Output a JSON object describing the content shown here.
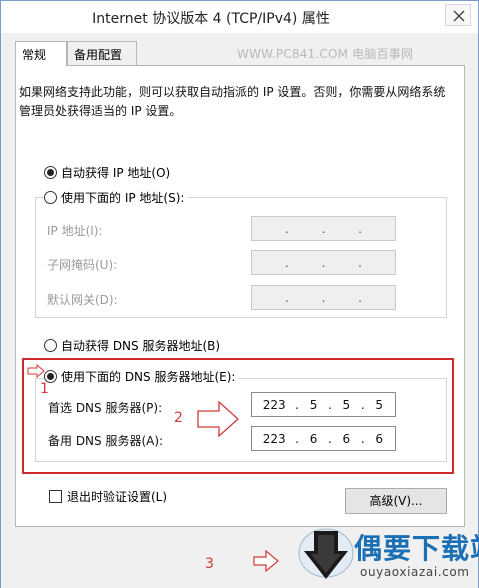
{
  "window": {
    "title": "Internet 协议版本 4 (TCP/IPv4) 属性"
  },
  "tabs": [
    {
      "label": "常规"
    },
    {
      "label": "备用配置"
    }
  ],
  "watermark": "WWW.PC841.COM 电脑百事网",
  "description": "如果网络支持此功能，则可以获取自动指派的 IP 设置。否则，你需要从网络系统管理员处获得适当的 IP 设置。",
  "ip_section": {
    "auto_label": "自动获得 IP 地址(O)",
    "auto_checked": true,
    "manual_label": "使用下面的 IP 地址(S):",
    "manual_checked": false,
    "fields": [
      {
        "label": "IP 地址(I):",
        "value": [
          "",
          "",
          "",
          ""
        ]
      },
      {
        "label": "子网掩码(U):",
        "value": [
          "",
          "",
          "",
          ""
        ]
      },
      {
        "label": "默认网关(D):",
        "value": [
          "",
          "",
          "",
          ""
        ]
      }
    ]
  },
  "dns_section": {
    "auto_label": "自动获得 DNS 服务器地址(B)",
    "auto_checked": false,
    "manual_label": "使用下面的 DNS 服务器地址(E):",
    "manual_checked": true,
    "preferred_label": "首选 DNS 服务器(P):",
    "preferred_value": [
      "223",
      "5",
      "5",
      "5"
    ],
    "alternate_label": "备用 DNS 服务器(A):",
    "alternate_value": [
      "223",
      "6",
      "6",
      "6"
    ]
  },
  "validate_label": "退出时验证设置(L)",
  "advanced_label": "高级(V)...",
  "annotations": {
    "step1": "1",
    "step2": "2",
    "step3": "3",
    "accent": "#cf2a2a"
  },
  "logo": {
    "title": "偶要下载站",
    "subtitle": "ouyaoxiazai.com"
  }
}
